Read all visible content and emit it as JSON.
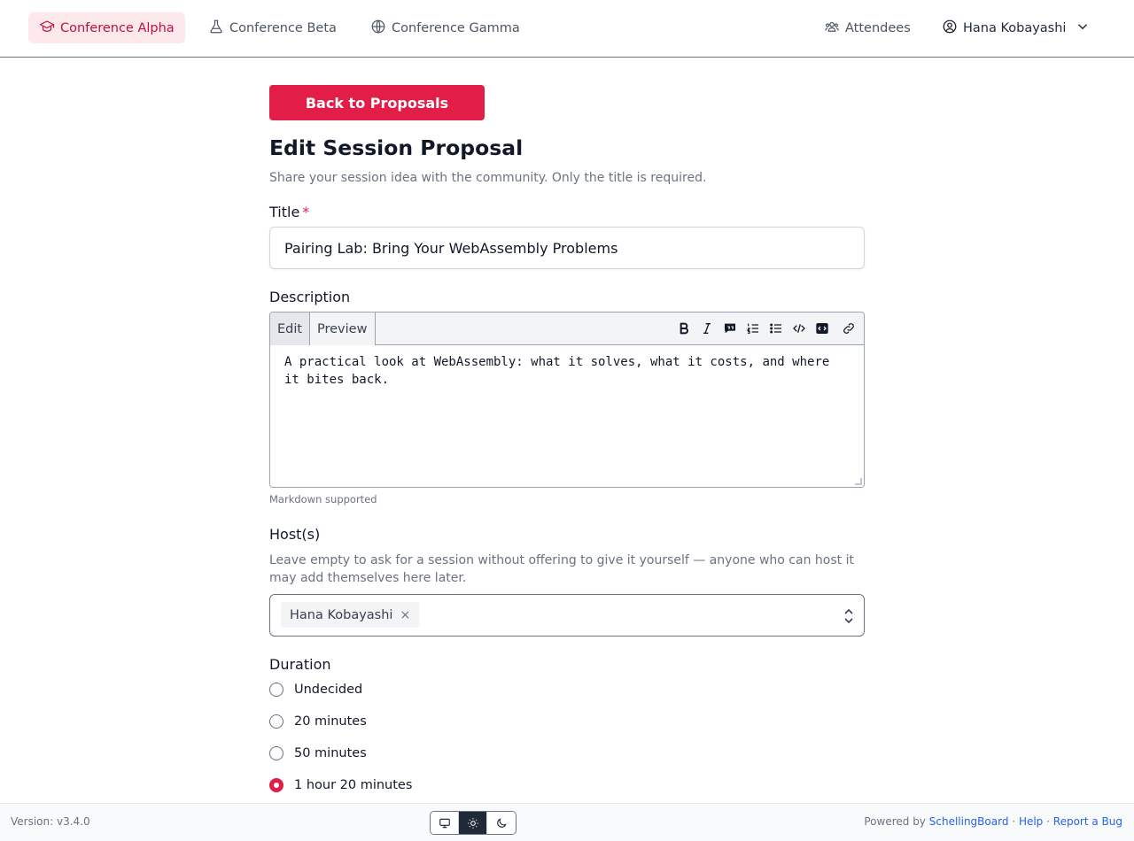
{
  "nav": {
    "items": [
      {
        "label": "Conference Alpha",
        "icon": "graduation-cap-icon",
        "active": true
      },
      {
        "label": "Conference Beta",
        "icon": "flask-icon",
        "active": false
      },
      {
        "label": "Conference Gamma",
        "icon": "globe-icon",
        "active": false
      }
    ],
    "attendees_label": "Attendees",
    "user_name": "Hana Kobayashi"
  },
  "form": {
    "back_label": "Back to Proposals",
    "title": "Edit Session Proposal",
    "subtitle": "Share your session idea with the community. Only the title is required.",
    "title_label": "Title",
    "required_mark": "*",
    "title_value": "Pairing Lab: Bring Your WebAssembly Problems",
    "description_label": "Description",
    "editor_tabs": [
      "Edit",
      "Preview"
    ],
    "editor_tools": [
      "bold-icon",
      "italic-icon",
      "quote-icon",
      "ordered-list-icon",
      "unordered-list-icon",
      "code-icon",
      "code-block-icon",
      "link-icon"
    ],
    "description_value": "A practical look at WebAssembly: what it solves, what it costs, and where it bites back.",
    "markdown_hint": "Markdown supported",
    "hosts_label": "Host(s)",
    "hosts_help": "Leave empty to ask for a session without offering to give it yourself — anyone who can host it may add themselves here later.",
    "hosts": [
      "Hana Kobayashi"
    ],
    "remove_mark": "×",
    "duration_label": "Duration",
    "duration_options": [
      "Undecided",
      "20 minutes",
      "50 minutes",
      "1 hour 20 minutes"
    ],
    "duration_selected": "1 hour 20 minutes"
  },
  "footer": {
    "version": "Version: v3.4.0",
    "theme_options": [
      "system-monitor-icon",
      "sun-icon",
      "moon-icon"
    ],
    "theme_selected": "light",
    "powered_by": "Powered by",
    "brand": "SchellingBoard",
    "separator": "·",
    "help": "Help",
    "report": "Report a Bug"
  },
  "colors": {
    "accent": "#e11d48",
    "nav_active_bg": "#fde8ec",
    "link": "#2563eb"
  }
}
